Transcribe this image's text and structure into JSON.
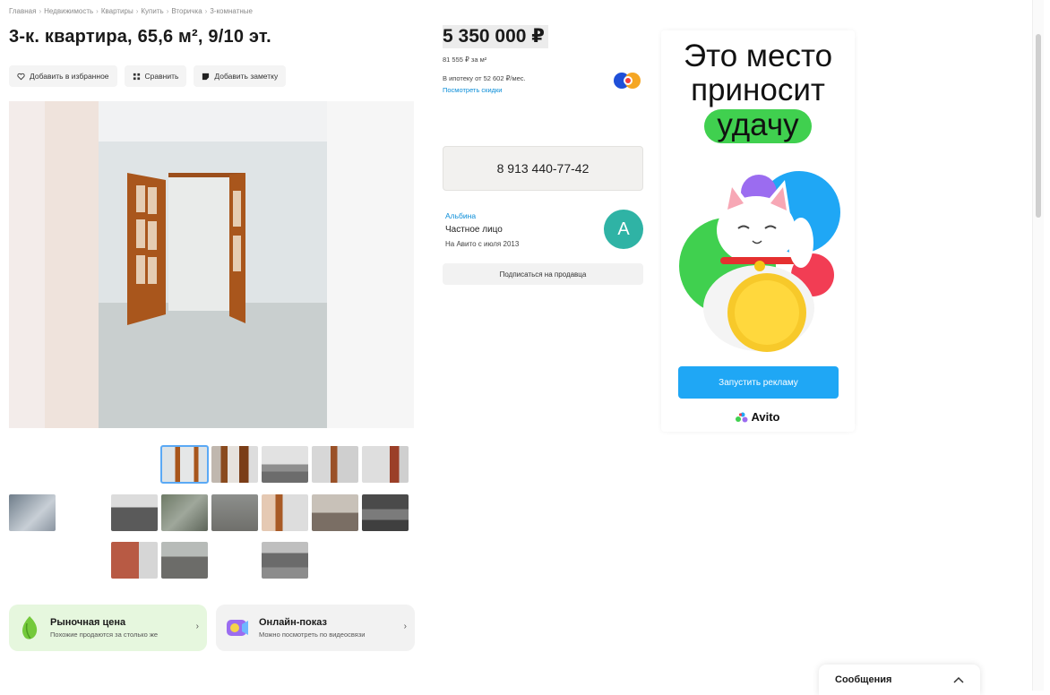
{
  "breadcrumb": [
    "Главная",
    "Недвижимость",
    "Квартиры",
    "Купить",
    "Вторичка",
    "3-комнатные"
  ],
  "title": "3-к. квартира, 65,6 м², 9/10 эт.",
  "actions": {
    "favorite": "Добавить в избранное",
    "compare": "Сравнить",
    "note": "Добавить заметку"
  },
  "price": {
    "value": "5 350 000 ₽",
    "per_meter": "81 555 ₽ за м²",
    "mortgage": "В ипотеку от 52 602 ₽/мес.",
    "discounts_link": "Посмотреть скидки"
  },
  "contact": {
    "phone": "8 913 440-77-42"
  },
  "seller": {
    "name": "Альбина",
    "type": "Частное лицо",
    "since": "На Авито с июля 2013",
    "avatar_letter": "A",
    "subscribe": "Подписаться на продавца"
  },
  "promos": [
    {
      "title": "Рыночная цена",
      "subtitle": "Похожие продаются за столько же"
    },
    {
      "title": "Онлайн-показ",
      "subtitle": "Можно посмотреть по видеосвязи"
    }
  ],
  "ad": {
    "line1": "Это место",
    "line2": "приносит",
    "highlight": "удачу",
    "button": "Запустить рекламу",
    "brand": "Avito"
  },
  "messages": {
    "label": "Сообщения"
  },
  "colors": {
    "accent_blue": "#1fa7f5",
    "link_blue": "#0a8dd8",
    "ad_green": "#40d04f",
    "avatar_teal": "#2fb3a5"
  }
}
